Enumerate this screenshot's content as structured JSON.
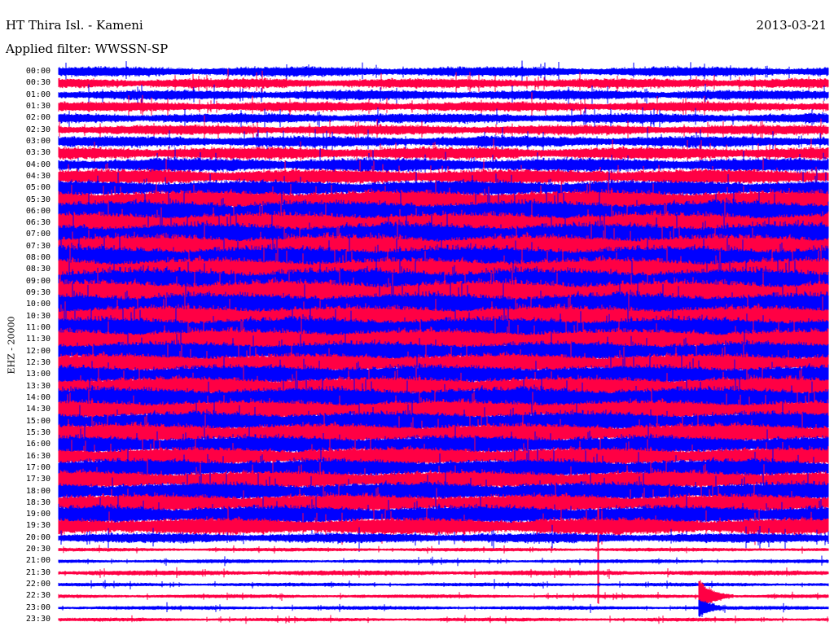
{
  "header": {
    "station": "HT Thira Isl. - Kameni",
    "filter": "Applied filter: WWSSN-SP",
    "date": "2013-03-21"
  },
  "chart_data": {
    "type": "line",
    "title": "HT Thira Isl. - Kameni",
    "subtitle": "Applied filter: WWSSN-SP",
    "date": "2013-03-21",
    "ylabel": "EHZ - 20000",
    "xlabel": "",
    "minutes_per_line": 30,
    "colors": [
      "#0000ff",
      "#ff0044"
    ],
    "row_labels": [
      "00:00",
      "00:30",
      "01:00",
      "01:30",
      "02:00",
      "02:30",
      "03:00",
      "03:30",
      "04:00",
      "04:30",
      "05:00",
      "05:30",
      "06:00",
      "06:30",
      "07:00",
      "07:30",
      "08:00",
      "08:30",
      "09:00",
      "09:30",
      "10:00",
      "10:30",
      "11:00",
      "11:30",
      "12:00",
      "12:30",
      "13:00",
      "13:30",
      "14:00",
      "14:30",
      "15:00",
      "15:30",
      "16:00",
      "16:30",
      "17:00",
      "17:30",
      "18:00",
      "18:30",
      "19:00",
      "19:30",
      "20:00",
      "20:30",
      "21:00",
      "21:30",
      "22:00",
      "22:30",
      "23:00",
      "23:30"
    ],
    "relative_amplitude": [
      8,
      8,
      8,
      8,
      8,
      8,
      9,
      10,
      11,
      12,
      13,
      16,
      18,
      18,
      20,
      20,
      20,
      20,
      22,
      22,
      20,
      18,
      18,
      18,
      16,
      16,
      16,
      16,
      18,
      16,
      16,
      16,
      15,
      15,
      15,
      15,
      15,
      15,
      15,
      14,
      8,
      3,
      3,
      4,
      3,
      3,
      3,
      3
    ],
    "events": [
      {
        "row": "20:30",
        "minute": 21,
        "relative_amplitude": 100
      },
      {
        "row": "22:30",
        "minute": 25,
        "relative_amplitude": 30
      },
      {
        "row": "23:00",
        "minute": 25,
        "relative_amplitude": 18
      }
    ]
  }
}
